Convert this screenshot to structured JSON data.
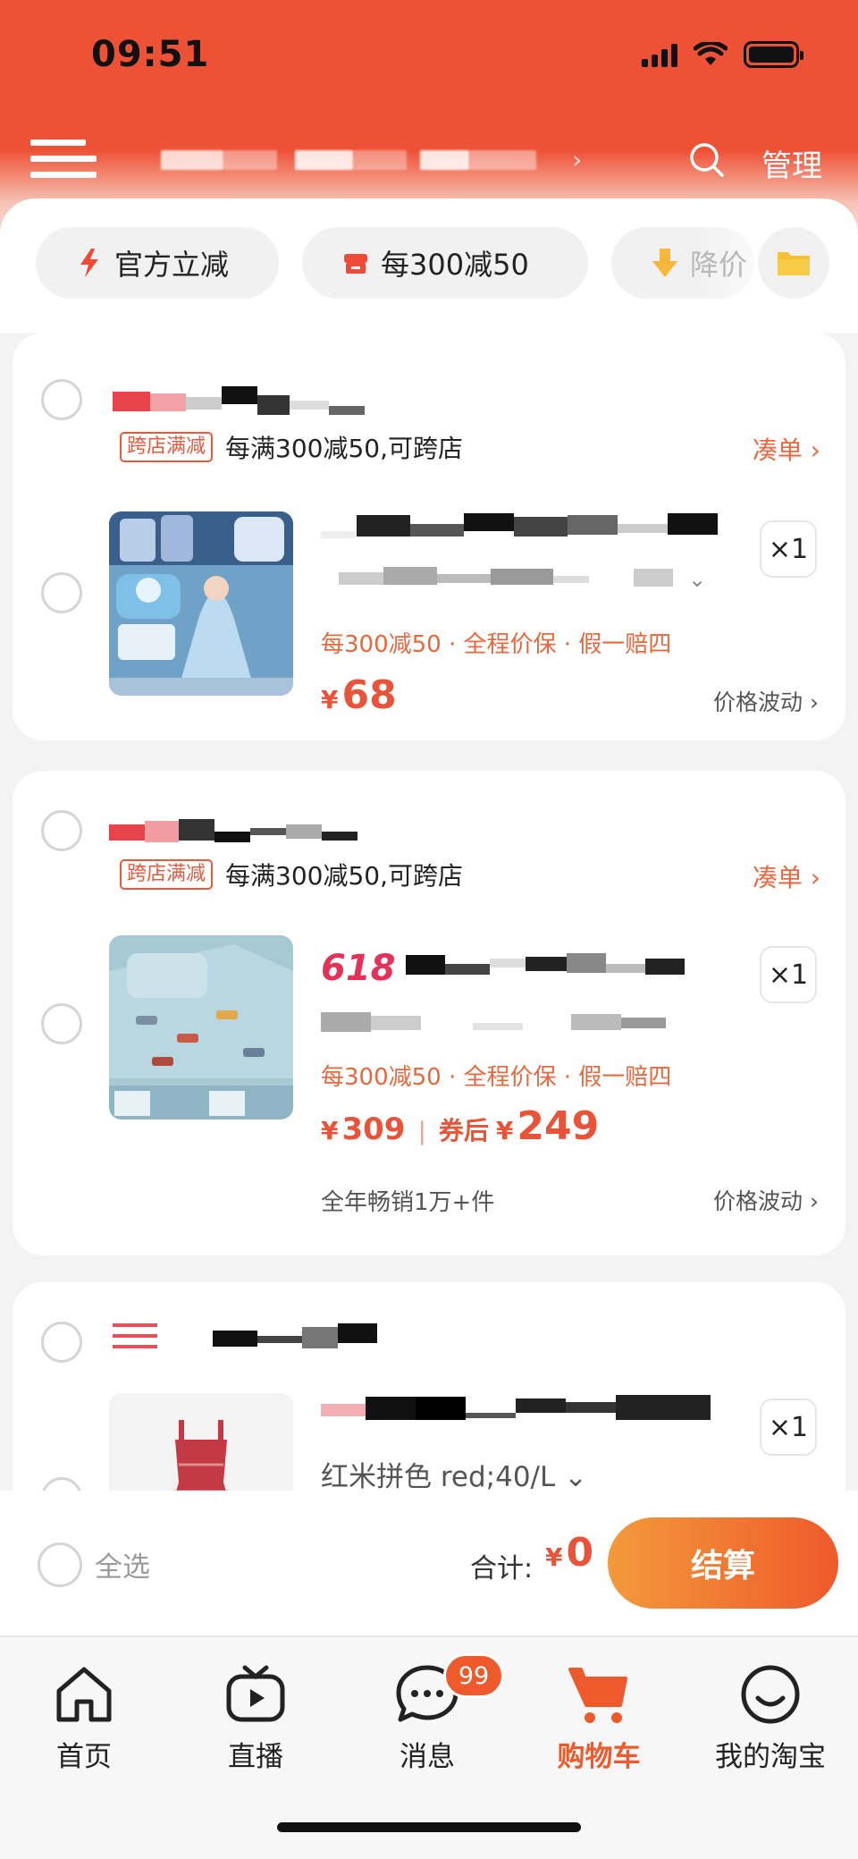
{
  "status_bar": {
    "time": "09:51"
  },
  "header": {
    "manage_label": "管理"
  },
  "chips": {
    "official": "官方立减",
    "discount": "每300减50",
    "price_drop": "降价"
  },
  "stores": [
    {
      "promo_tag": "跨店满减",
      "promo_text": "每满300减50,可跨店",
      "combine_label": "凑单 ›",
      "product": {
        "quantity": "×1",
        "services": "每300减50 · 全程价保 · 假一赔四",
        "price_yen": "¥",
        "price": "68",
        "price_trend": "价格波动 ›"
      }
    },
    {
      "promo_tag": "跨店满减",
      "promo_text": "每满300减50,可跨店",
      "combine_label": "凑单 ›",
      "product": {
        "badge": "618",
        "quantity": "×1",
        "services": "每300减50 · 全程价保 · 假一赔四",
        "price_yen": "¥",
        "price": "309",
        "after_coupon_label": "券后",
        "after_coupon_yen": "¥",
        "after_coupon_price": "249",
        "sales": "全年畅销1万+件",
        "price_trend": "价格波动 ›"
      }
    },
    {
      "product": {
        "quantity": "×1",
        "sku": "红米拼色 red;40/L ⌄"
      }
    }
  ],
  "checkout": {
    "select_all": "全选",
    "total_label": "合计:",
    "total_yen": "¥",
    "total_value": "0",
    "submit": "结算"
  },
  "tabbar": {
    "items": [
      {
        "label": "首页",
        "icon": "home-icon"
      },
      {
        "label": "直播",
        "icon": "live-play-icon"
      },
      {
        "label": "消息",
        "icon": "chat-bubble-icon"
      },
      {
        "label": "购物车",
        "icon": "shopping-cart-icon",
        "active": true
      },
      {
        "label": "我的淘宝",
        "icon": "smile-face-icon"
      }
    ],
    "messages_badge": "99"
  },
  "colors": {
    "brand": "#EE5236",
    "accent": "#E8543A",
    "promo": "#E8683E",
    "checkout_gradient_start": "#F39A3B",
    "checkout_gradient_end": "#EE5A2B"
  }
}
